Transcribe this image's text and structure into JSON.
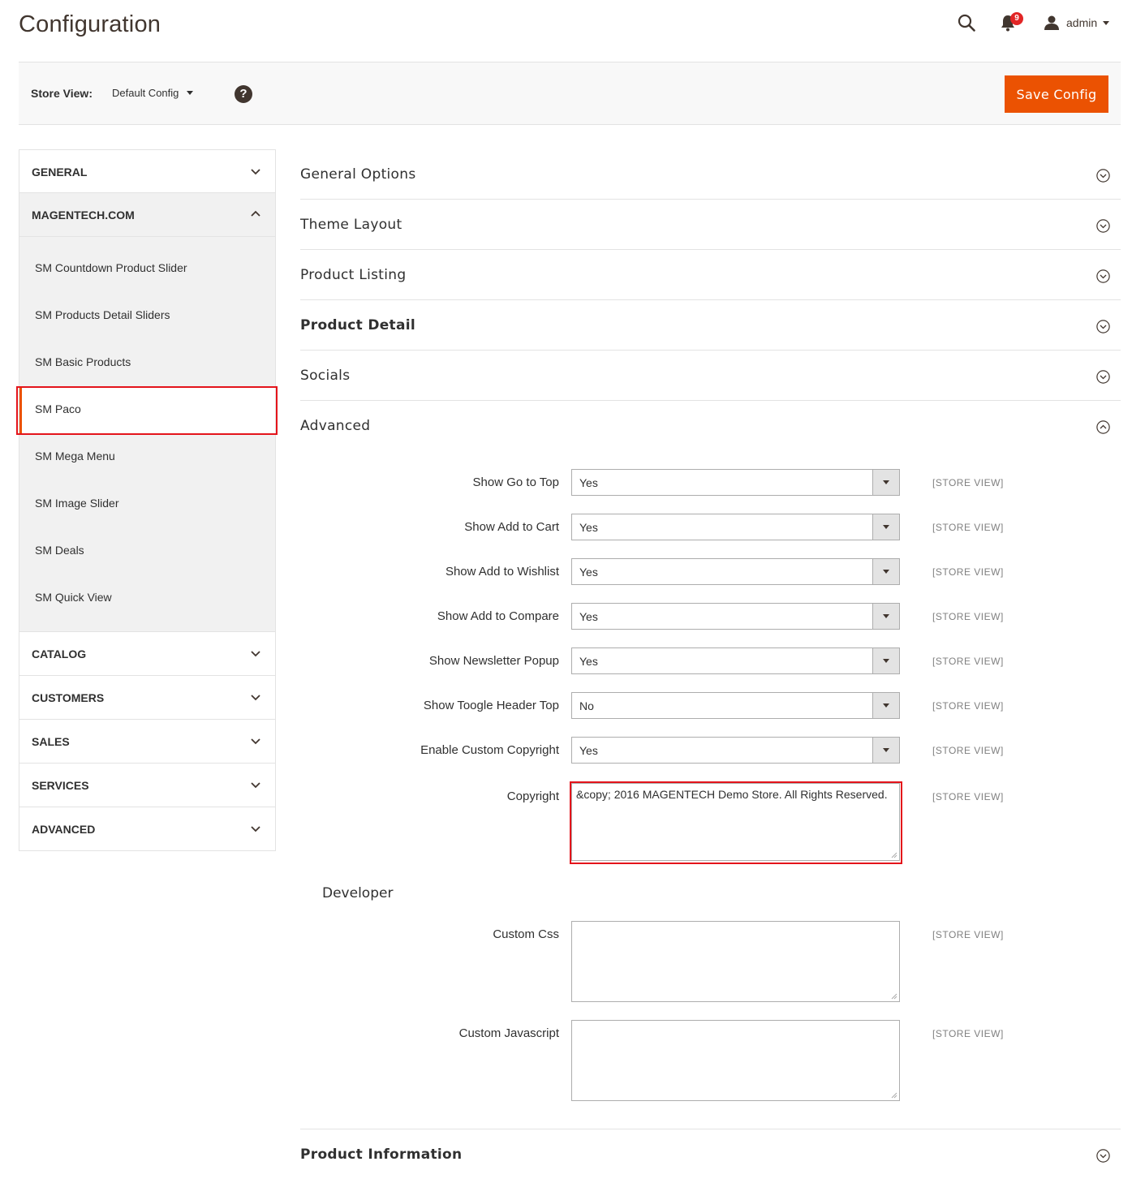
{
  "header": {
    "title": "Configuration",
    "notification_count": "9",
    "user_name": "admin"
  },
  "store_bar": {
    "label": "Store View:",
    "selected": "Default Config",
    "help": "?",
    "save_label": "Save Config"
  },
  "sidebar": {
    "tabs_top": [
      {
        "label": "GENERAL"
      },
      {
        "label": "MAGENTECH.COM"
      }
    ],
    "sub_items": [
      {
        "label": "SM Countdown Product Slider"
      },
      {
        "label": "SM Products Detail Sliders"
      },
      {
        "label": "SM Basic Products"
      },
      {
        "label": "SM Paco"
      },
      {
        "label": "SM Mega Menu"
      },
      {
        "label": "SM Image Slider"
      },
      {
        "label": "SM Deals"
      },
      {
        "label": "SM Quick View"
      }
    ],
    "tabs_bottom": [
      {
        "label": "CATALOG"
      },
      {
        "label": "CUSTOMERS"
      },
      {
        "label": "SALES"
      },
      {
        "label": "SERVICES"
      },
      {
        "label": "ADVANCED"
      }
    ]
  },
  "sections": [
    {
      "title": "General Options"
    },
    {
      "title": "Theme Layout"
    },
    {
      "title": "Product Listing"
    },
    {
      "title": "Product Detail"
    },
    {
      "title": "Socials"
    },
    {
      "title": "Advanced"
    }
  ],
  "advanced": {
    "fields": [
      {
        "label": "Show Go to Top",
        "value": "Yes",
        "scope": "[STORE VIEW]"
      },
      {
        "label": "Show Add to Cart",
        "value": "Yes",
        "scope": "[STORE VIEW]"
      },
      {
        "label": "Show Add to Wishlist",
        "value": "Yes",
        "scope": "[STORE VIEW]"
      },
      {
        "label": "Show Add to Compare",
        "value": "Yes",
        "scope": "[STORE VIEW]"
      },
      {
        "label": "Show Newsletter Popup",
        "value": "Yes",
        "scope": "[STORE VIEW]"
      },
      {
        "label": "Show Toogle Header Top",
        "value": "No",
        "scope": "[STORE VIEW]"
      },
      {
        "label": "Enable Custom Copyright",
        "value": "Yes",
        "scope": "[STORE VIEW]"
      }
    ],
    "copyright": {
      "label": "Copyright",
      "value": "&copy;  2016 MAGENTECH Demo Store. All Rights Reserved.",
      "scope": "[STORE VIEW]"
    },
    "developer_heading": "Developer",
    "custom_css": {
      "label": "Custom Css",
      "value": "",
      "scope": "[STORE VIEW]"
    },
    "custom_js": {
      "label": "Custom Javascript",
      "value": "",
      "scope": "[STORE VIEW]"
    }
  },
  "last_section": {
    "title": "Product Information"
  },
  "colors": {
    "accent": "#eb5202",
    "highlight": "#e4141b",
    "badge": "#e22626"
  },
  "icons": [
    "search-icon",
    "bell-icon",
    "user-icon",
    "help-icon",
    "chevron-down-icon",
    "chevron-up-icon",
    "circle-chevron-icon"
  ]
}
